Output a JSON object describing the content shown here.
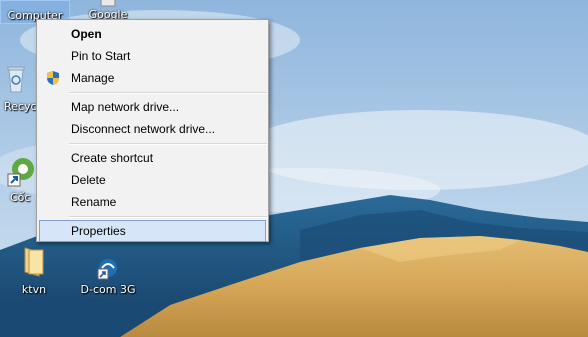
{
  "desktop": {
    "icons": [
      {
        "name": "computer",
        "label": "Computer"
      },
      {
        "name": "google",
        "label": "Google"
      },
      {
        "name": "recycle-bin",
        "label": "Recyc"
      },
      {
        "name": "coccoc",
        "label": "Cốc"
      },
      {
        "name": "ktvn",
        "label": "ktvn"
      },
      {
        "name": "dcom",
        "label": "D-com 3G"
      }
    ]
  },
  "context_menu": {
    "items": [
      {
        "label": "Open",
        "default": true
      },
      {
        "label": "Pin to Start"
      },
      {
        "label": "Manage",
        "icon": "uac-shield-icon"
      },
      {
        "label": "Map network drive..."
      },
      {
        "label": "Disconnect network drive..."
      },
      {
        "label": "Create shortcut"
      },
      {
        "label": "Delete"
      },
      {
        "label": "Rename"
      },
      {
        "label": "Properties",
        "highlighted": true
      }
    ]
  },
  "colors": {
    "menu_background": "#f2f2f2",
    "menu_highlight": "#d6e6f8",
    "menu_highlight_border": "#7da2ce",
    "sky": "#9fc0e2",
    "hills": "#1f5a8a",
    "sand": "#d9ac5e"
  }
}
